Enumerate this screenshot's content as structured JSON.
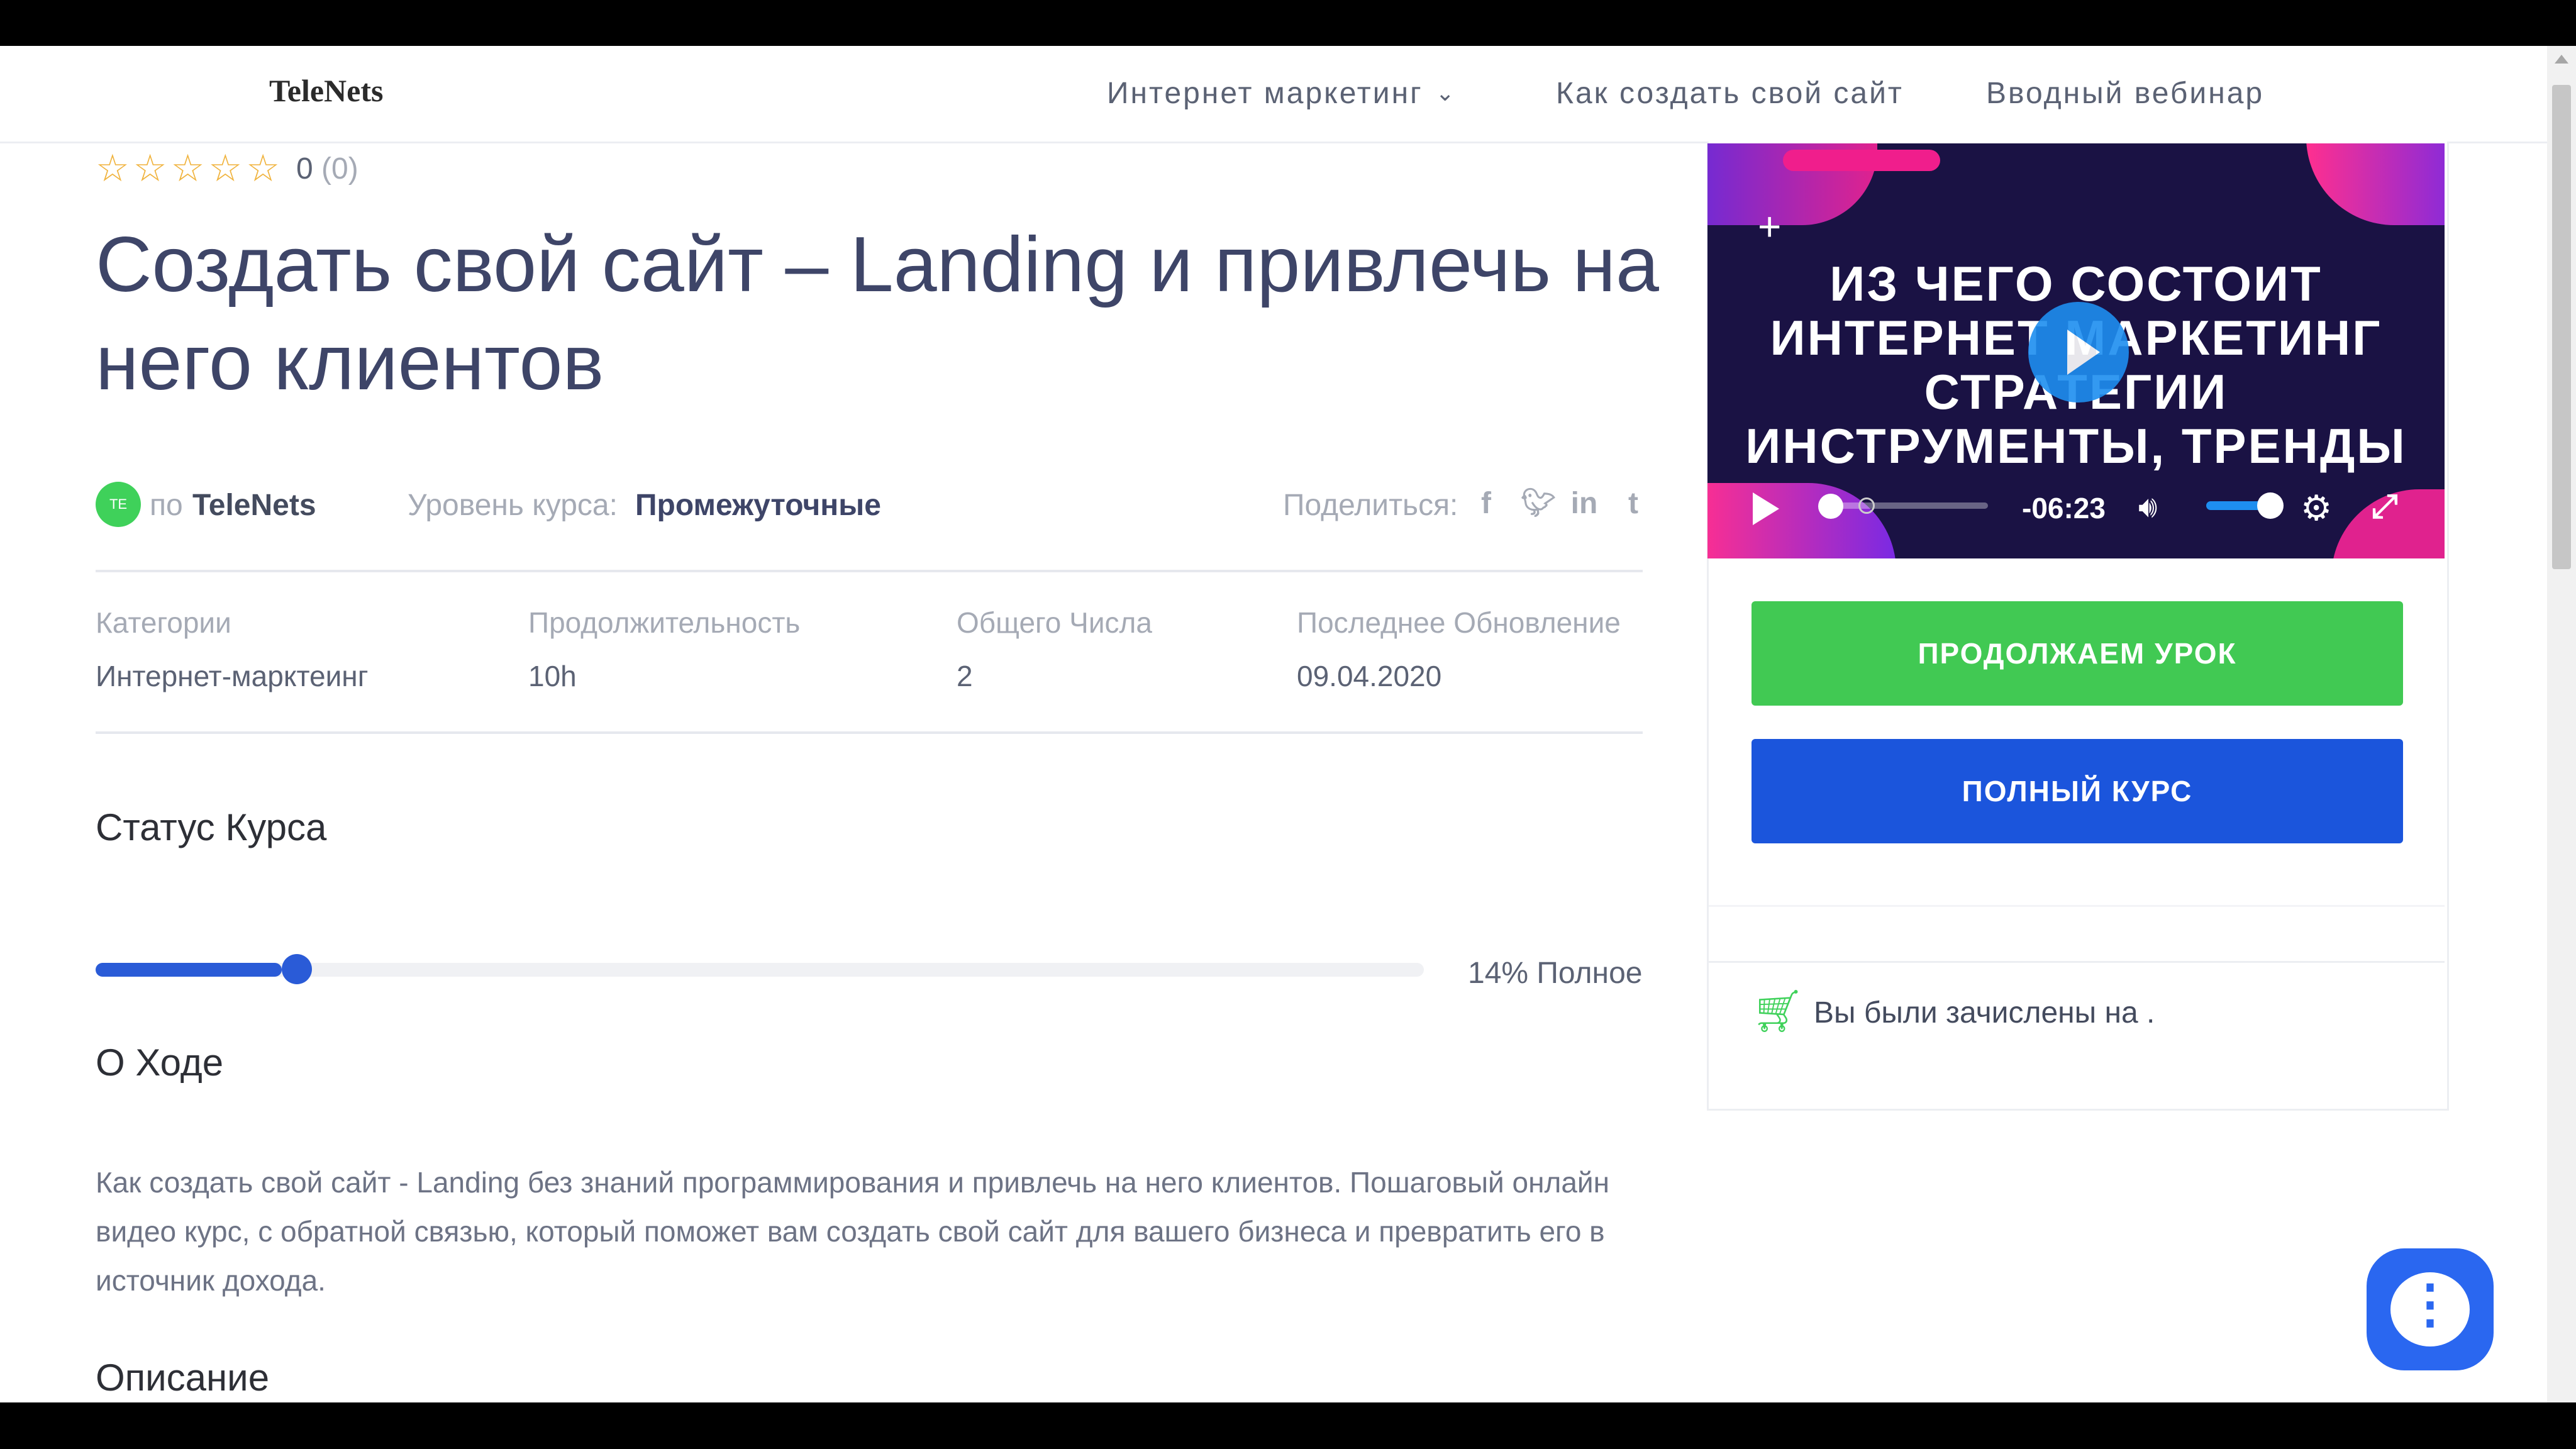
{
  "header": {
    "logo": "TeleNets",
    "nav": [
      {
        "label": "Интернет маркетинг"
      },
      {
        "label": "Как создать свой сайт"
      },
      {
        "label": "Вводный вебинар"
      }
    ]
  },
  "rating": {
    "value": "0",
    "count": "(0)",
    "stars": 0,
    "star_color": "#f0b33d"
  },
  "course": {
    "title": "Создать свой сайт – Landing и привлечь на него клиентов",
    "author_prefix": "по",
    "author": "TeleNets",
    "avatar_initials": "TE",
    "level_label": "Уровень курса:",
    "level_value": "Промежуточные",
    "share_label": "Поделиться:",
    "share_icons": [
      "facebook-icon",
      "twitter-icon",
      "linkedin-icon",
      "tumblr-icon"
    ]
  },
  "info": {
    "columns": [
      {
        "label": "Категории",
        "value": "Интернет-марктеинг"
      },
      {
        "label": "Продолжительность",
        "value": "10h"
      },
      {
        "label": "Общего Числа",
        "value": "2"
      },
      {
        "label": "Последнее Обновление",
        "value": "09.04.2020"
      }
    ]
  },
  "status": {
    "heading": "Статус Курса",
    "progress_percent": 14,
    "progress_label": "14% Полное"
  },
  "about": {
    "heading": "О Ходе",
    "text": "Как создать свой сайт - Landing без знаний программирования и привлечь на него клиентов. Пошаговый онлайн видео курс, с обратной связью, который поможет вам создать свой сайт для вашего бизнеса и превратить его в источник дохода."
  },
  "description": {
    "heading": "Описание"
  },
  "video": {
    "overlay_text": "ИЗ ЧЕГО СОСТОИТ ИНТЕРНЕТ МАРКЕТИНГ СТРАТЕГИИ ИНСТРУМЕНТЫ, ТРЕНДЫ",
    "time": "-06:23",
    "volume_percent": 80
  },
  "sidebar": {
    "continue_button": "ПРОДОЛЖАЕМ УРОК",
    "full_course_button": "ПОЛНЫЙ КУРС",
    "enrolled_text": "Вы были зачислены на ."
  },
  "colors": {
    "accent_blue": "#1b55dc",
    "accent_green": "#41c953",
    "title_color": "#3e4568"
  }
}
